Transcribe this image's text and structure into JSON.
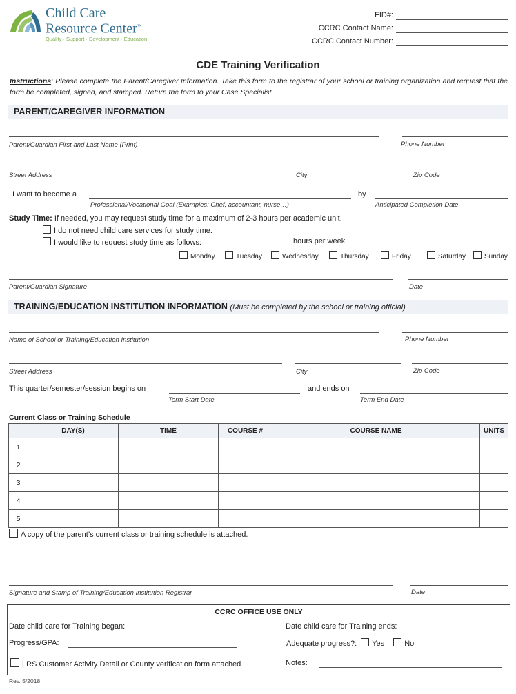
{
  "header": {
    "logo": {
      "line1": "Child Care",
      "line2": "Resource Center",
      "tm": "™",
      "tagline": "Quality · Support · Development · Education",
      "colors": {
        "green": "#7cb342",
        "blue": "#2f6d8f",
        "light_blue": "#8fb9d9"
      }
    },
    "fields": [
      {
        "label": "FID#:"
      },
      {
        "label": "CCRC Contact Name:"
      },
      {
        "label": "CCRC Contact Number:"
      }
    ]
  },
  "title": "CDE Training Verification",
  "instructions": {
    "label": "Instructions",
    "text": ": Please complete the Parent/Caregiver Information. Take this form to the registrar of your school or training organization and request that the form be completed, signed, and stamped. Return the form to your Case Specialist."
  },
  "parent_section": {
    "heading": "PARENT/CAREGIVER INFORMATION",
    "name_label": "Parent/Guardian First and Last Name (Print)",
    "phone_label": "Phone Number",
    "street_label": "Street Address",
    "city_label": "City",
    "zip_label": "Zip Code",
    "goal_prefix": "I want to become a",
    "goal_by": "by",
    "goal_label": "Professional/Vocational Goal (Examples: Chef, accountant, nurse…)",
    "completion_label": "Anticipated Completion Date",
    "study_time_label": "Study Time:",
    "study_time_text": " If needed, you may request study time for a maximum of 2-3 hours per academic unit.",
    "option_no_need": "I do not need child care services for study time.",
    "option_request": "I would like to request study time as follows:",
    "hours_suffix": "hours per week",
    "days": [
      "Monday",
      "Tuesday",
      "Wednesday",
      "Thursday",
      "Friday",
      "Saturday",
      "Sunday"
    ],
    "signature_label": "Parent/Guardian Signature",
    "date_label": "Date"
  },
  "institution_section": {
    "heading": "TRAINING/EDUCATION INSTITUTION INFORMATION",
    "heading_note": "(Must be completed by the school or training official)",
    "name_label": "Name of School or Training/Education Institution",
    "phone_label": "Phone Number",
    "street_label": "Street Address",
    "city_label": "City",
    "zip_label": "Zip Code",
    "term_prefix": "This quarter/semester/session begins on",
    "term_mid": "and ends on",
    "term_start_label": "Term Start Date",
    "term_end_label": "Term End Date"
  },
  "schedule": {
    "title": "Current Class or Training Schedule",
    "columns": [
      "",
      "DAY(S)",
      "TIME",
      "COURSE #",
      "COURSE NAME",
      "UNITS"
    ],
    "rows": [
      [
        "1",
        "",
        "",
        "",
        "",
        ""
      ],
      [
        "2",
        "",
        "",
        "",
        "",
        ""
      ],
      [
        "3",
        "",
        "",
        "",
        "",
        ""
      ],
      [
        "4",
        "",
        "",
        "",
        "",
        ""
      ],
      [
        "5",
        "",
        "",
        "",
        "",
        ""
      ]
    ],
    "attached_label": "A copy of the parent’s current class or training schedule is attached."
  },
  "registrar": {
    "signature_label": "Signature and Stamp of Training/Education Institution Registrar",
    "date_label": "Date"
  },
  "office_use": {
    "heading": "CCRC OFFICE USE ONLY",
    "began_label": "Date child care for Training began:",
    "ends_label": "Date child care for Training ends:",
    "gpa_label": "Progress/GPA:",
    "adequate_label": "Adequate progress?:",
    "yes_label": "Yes",
    "no_label": "No",
    "lrs_label": "LRS Customer Activity Detail or County verification form attached",
    "notes_label": "Notes:"
  },
  "footer": {
    "revision": "Rev. 5/2018"
  }
}
